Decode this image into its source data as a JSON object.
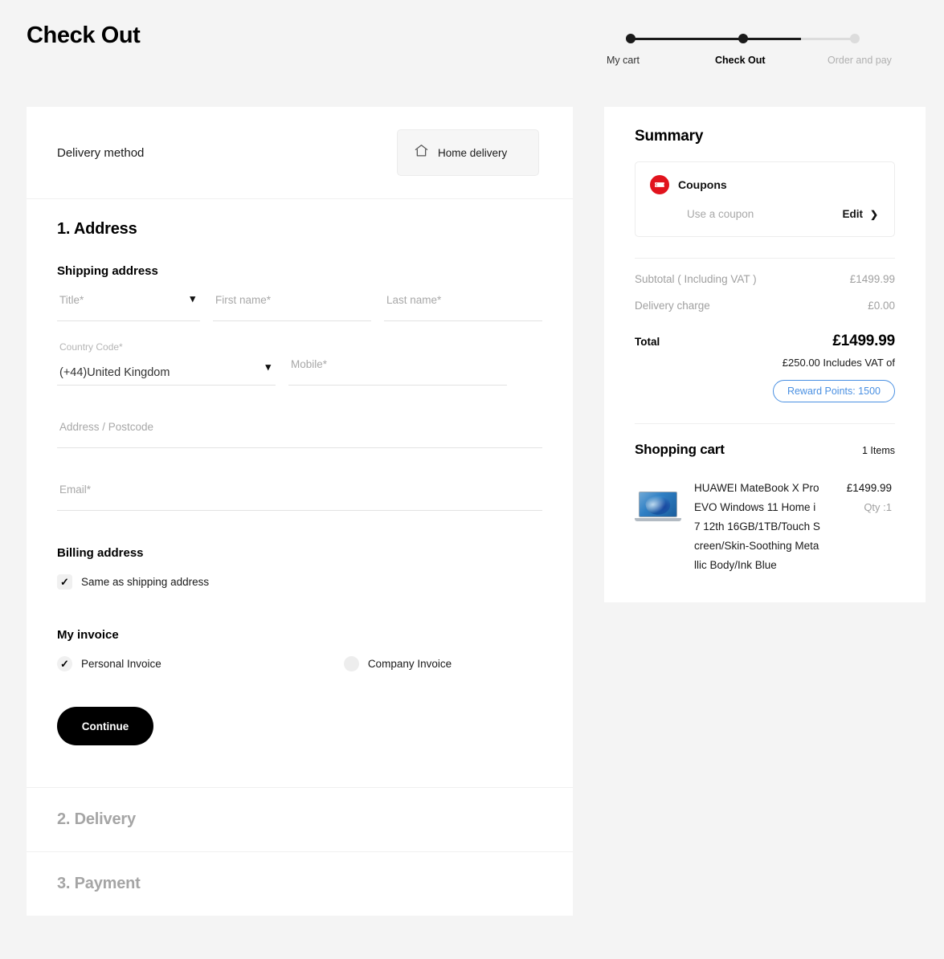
{
  "page": {
    "title": "Check Out"
  },
  "stepper": {
    "steps": [
      {
        "label": "My cart",
        "state": "done"
      },
      {
        "label": "Check Out",
        "state": "current"
      },
      {
        "label": "Order and pay",
        "state": "todo"
      }
    ]
  },
  "delivery_method": {
    "label": "Delivery method",
    "selected_option": "Home delivery",
    "icon": "home-icon"
  },
  "address_section": {
    "heading": "1. Address",
    "shipping_heading": "Shipping address",
    "fields": {
      "title": {
        "placeholder": "Title*",
        "value": ""
      },
      "first_name": {
        "placeholder": "First name*",
        "value": ""
      },
      "last_name": {
        "placeholder": "Last name*",
        "value": ""
      },
      "country_code": {
        "label": "Country Code*",
        "value": "(+44)United Kingdom"
      },
      "mobile": {
        "placeholder": "Mobile*",
        "value": ""
      },
      "address": {
        "placeholder": "Address / Postcode",
        "value": ""
      },
      "email": {
        "placeholder": "Email*",
        "value": ""
      }
    },
    "billing_heading": "Billing address",
    "same_as_shipping": {
      "label": "Same as shipping address",
      "checked": true
    },
    "invoice_heading": "My invoice",
    "invoice_options": [
      {
        "label": "Personal Invoice",
        "selected": true
      },
      {
        "label": "Company Invoice",
        "selected": false
      }
    ],
    "continue_label": "Continue"
  },
  "collapsed_sections": [
    {
      "label": "2. Delivery"
    },
    {
      "label": "3. Payment"
    }
  ],
  "summary": {
    "title": "Summary",
    "coupons": {
      "title": "Coupons",
      "hint": "Use a coupon",
      "edit_label": "Edit",
      "icon": "coupon-ticket-icon",
      "badge_color": "#e1131d"
    },
    "price_lines": [
      {
        "label": "Subtotal ( Including VAT )",
        "amount": "£1499.99"
      },
      {
        "label": "Delivery charge",
        "amount": "£0.00"
      }
    ],
    "total": {
      "label": "Total",
      "amount": "£1499.99"
    },
    "vat_note": "£250.00 Includes VAT of",
    "reward_pill": {
      "label": "Reward Points: 1500",
      "color": "#4a90e2"
    },
    "cart": {
      "title": "Shopping cart",
      "count": "1 Items",
      "items": [
        {
          "name": "HUAWEI MateBook X Pro EVO Windows 11 Home i7 12th 16GB/1TB/Touch Screen/Skin-Soothing Metallic Body/Ink Blue",
          "price": "£1499.99",
          "qty": "Qty :1",
          "thumb": "laptop-blue-wallpaper"
        }
      ]
    }
  }
}
